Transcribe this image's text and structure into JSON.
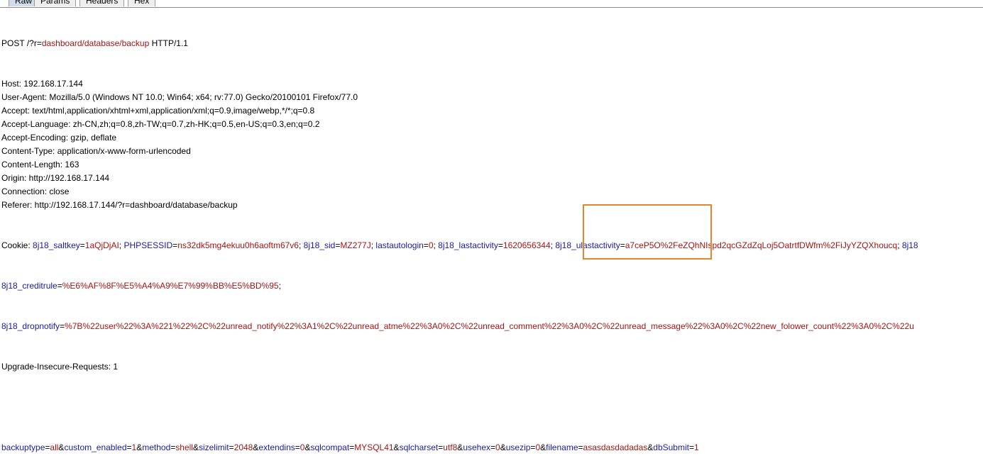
{
  "tabs": [
    "Raw",
    "Params",
    "Headers",
    "Hex"
  ],
  "request": {
    "method": "POST",
    "path_prefix": "/?r=",
    "path_value": "dashboard/database/backup",
    "protocol": "HTTP/1.1",
    "headers": [
      "Host: 192.168.17.144",
      "User-Agent: Mozilla/5.0 (Windows NT 10.0; Win64; x64; rv:77.0) Gecko/20100101 Firefox/77.0",
      "Accept: text/html,application/xhtml+xml,application/xml;q=0.9,image/webp,*/*;q=0.8",
      "Accept-Language: zh-CN,zh;q=0.8,zh-TW;q=0.7,zh-HK;q=0.5,en-US;q=0.3,en;q=0.2",
      "Accept-Encoding: gzip, deflate",
      "Content-Type: application/x-www-form-urlencoded",
      "Content-Length: 163",
      "Origin: http://192.168.17.144",
      "Connection: close",
      "Referer: http://192.168.17.144/?r=dashboard/database/backup"
    ],
    "cookie_label": "Cookie: ",
    "cookies_line1": [
      {
        "k": "8j18_saltkey",
        "v": "1aQjDjAI"
      },
      {
        "k": "PHPSESSID",
        "v": "ns32dk5mg4ekuu0h6aoftm67v6"
      },
      {
        "k": "8j18_sid",
        "v": "MZ277J"
      },
      {
        "k": "lastautologin",
        "v": "0"
      },
      {
        "k": "8j18_lastactivity",
        "v": "1620656344"
      },
      {
        "k": "8j18_ulastactivity",
        "v": "a7ceP5O%2FeZQhNIspd2qcGZdZqLoj5OatrtfDWfm%2FiJyYZQXhoucq"
      },
      {
        "k": "8j18",
        "v": ""
      }
    ],
    "cookies_line2": [
      {
        "k": "8j18_creditrule",
        "v": "%E6%AF%8F%E5%A4%A9%E7%99%BB%E5%BD%95"
      }
    ],
    "cookies_line3": [
      {
        "k": "8j18_dropnotify",
        "v": "%7B%22user%22%3A%221%22%2C%22unread_notify%22%3A1%2C%22unread_atme%22%3A0%2C%22unread_comment%22%3A0%2C%22unread_message%22%3A0%2C%22new_folower_count%22%3A0%2C%22u"
      }
    ],
    "upgrade_header": "Upgrade-Insecure-Requests: 1",
    "body_params": [
      {
        "k": "backuptype",
        "v": "all"
      },
      {
        "k": "custom_enabled",
        "v": "1"
      },
      {
        "k": "method",
        "v": "shell"
      },
      {
        "k": "sizelimit",
        "v": "2048"
      },
      {
        "k": "extendins",
        "v": "0"
      },
      {
        "k": "sqlcompat",
        "v": "MYSQL41"
      },
      {
        "k": "sqlcharset",
        "v": "utf8"
      },
      {
        "k": "usehex",
        "v": "0"
      },
      {
        "k": "usezip",
        "v": "0"
      },
      {
        "k": "filename",
        "v": "asasdasdadadas"
      },
      {
        "k": "dbSubmit",
        "v": "1"
      }
    ]
  },
  "colors": {
    "key": "#1a1aa6",
    "value": "#a31515",
    "highlight": "#e8852b"
  }
}
